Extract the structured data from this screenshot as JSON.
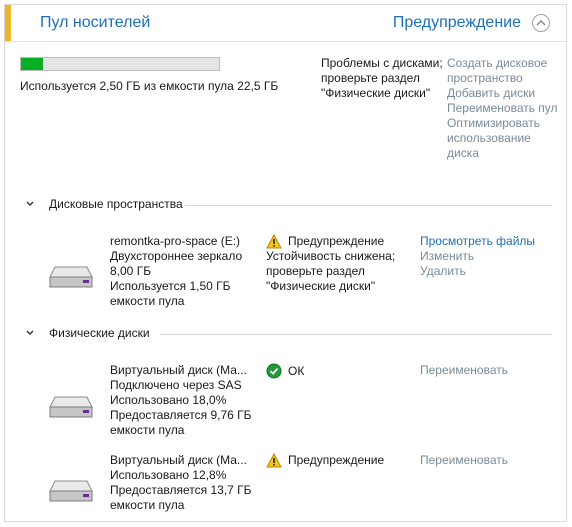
{
  "header": {
    "title": "Пул носителей",
    "status": "Предупреждение"
  },
  "pool": {
    "usage_fraction": 0.111,
    "usage_text": "Используется 2,50 ГБ из емкости пула 22,5 ГБ",
    "problem_lines": [
      "Проблемы с дисками;",
      "проверьте раздел",
      "\"Физические диски\""
    ],
    "actions": [
      "Создать дисковое пространство",
      "Добавить диски",
      "Переименовать пул",
      "Оптимизировать использование диска"
    ]
  },
  "spaces_section": {
    "label": "Дисковые пространства",
    "items": [
      {
        "lines": [
          "remontka-pro-space (E:)",
          "Двухстороннее зеркало",
          "8,00 ГБ",
          "Используется 1,50 ГБ",
          "емкости пула"
        ],
        "status": "Предупреждение",
        "status_lines": [
          "Устойчивость снижена;",
          "проверьте раздел",
          "\"Физические диски\""
        ],
        "actions": [
          "Просмотреть файлы",
          "Изменить",
          "Удалить"
        ]
      }
    ]
  },
  "disks_section": {
    "label": "Физические диски",
    "items": [
      {
        "lines": [
          "Виртуальный диск (Ма...",
          "Подключено через SAS",
          "Использовано 18,0%",
          "Предоставляется 9,76 ГБ",
          "емкости пула"
        ],
        "status": "ОК",
        "action": "Переименовать"
      },
      {
        "lines": [
          "Виртуальный диск (Ма...",
          "Использовано 12,8%",
          "Предоставляется 13,7 ГБ",
          "емкости пула"
        ],
        "status": "Предупреждение",
        "action": "Переименовать"
      }
    ]
  },
  "colors": {
    "accent": "#f0b429",
    "link": "#1e6fba",
    "disabled_link": "#7a8a99",
    "progress": "#06b025",
    "ok": "#1f9b3a"
  }
}
